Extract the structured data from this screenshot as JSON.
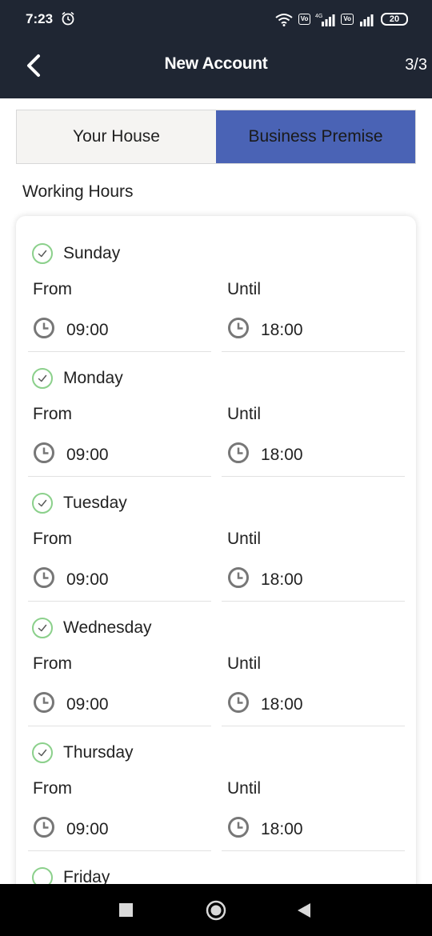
{
  "status_bar": {
    "time": "7:23",
    "battery": "20"
  },
  "header": {
    "title": "New Account",
    "step": "3/3"
  },
  "tabs": [
    {
      "label": "Your House",
      "active": false
    },
    {
      "label": "Business Premise",
      "active": true
    }
  ],
  "section_label": "Working Hours",
  "labels": {
    "from": "From",
    "until": "Until"
  },
  "days": [
    {
      "name": "Sunday",
      "from": "09:00",
      "until": "18:00",
      "checked": true
    },
    {
      "name": "Monday",
      "from": "09:00",
      "until": "18:00",
      "checked": true
    },
    {
      "name": "Tuesday",
      "from": "09:00",
      "until": "18:00",
      "checked": true
    },
    {
      "name": "Wednesday",
      "from": "09:00",
      "until": "18:00",
      "checked": true
    },
    {
      "name": "Thursday",
      "from": "09:00",
      "until": "18:00",
      "checked": true
    },
    {
      "name": "Friday",
      "from": "",
      "until": "",
      "checked": false
    }
  ],
  "colors": {
    "header_bg": "#1f2633",
    "active_tab": "#4a63b5",
    "check_green": "#8bd08b"
  }
}
